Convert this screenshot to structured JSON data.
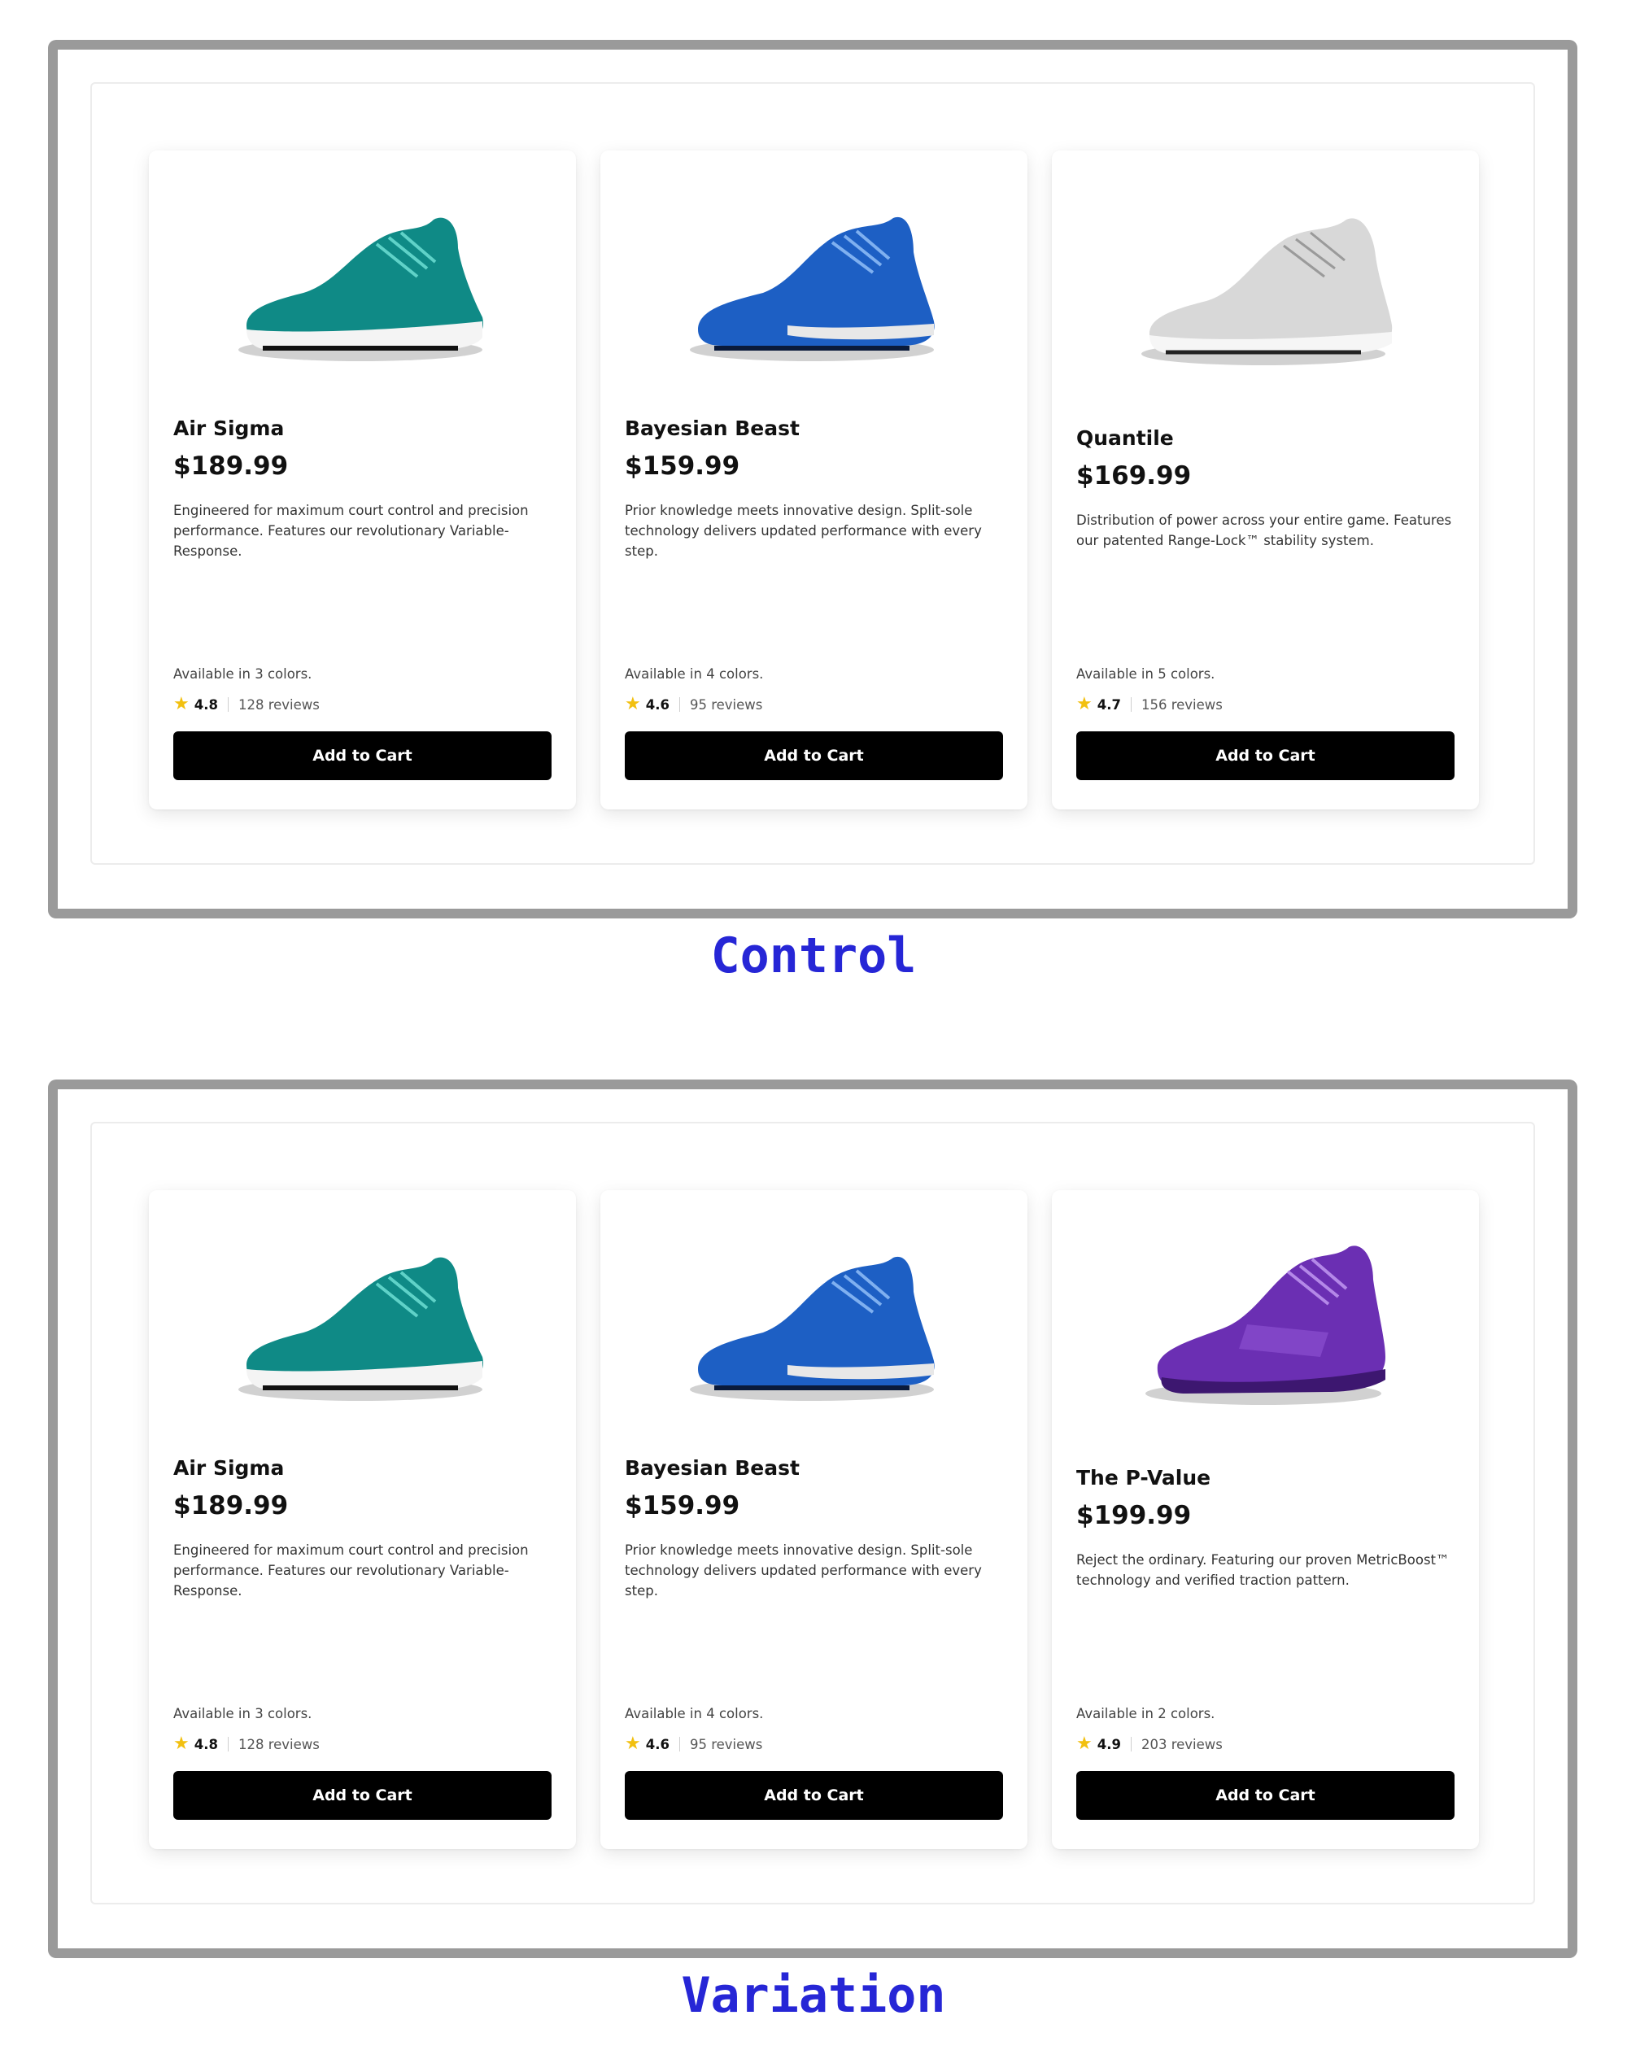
{
  "control": {
    "label": "Control",
    "products": [
      {
        "name": "Air Sigma",
        "price": "$189.99",
        "description": "Engineered for maximum court control and precision performance. Features our revolutionary Variable-Response.",
        "colors_text": "Available in 3 colors.",
        "rating": "4.8",
        "reviews": "128 reviews",
        "cta": "Add to Cart",
        "shoe_color": "#0f8a86",
        "shoe_image": "teal-sneaker"
      },
      {
        "name": "Bayesian Beast",
        "price": "$159.99",
        "description": "Prior knowledge meets innovative design. Split-sole technology delivers updated performance with every step.",
        "colors_text": "Available in 4 colors.",
        "rating": "4.6",
        "reviews": "95 reviews",
        "cta": "Add to Cart",
        "shoe_color": "#1d5fc4",
        "shoe_image": "blue-sneaker"
      },
      {
        "name": "Quantile",
        "price": "$169.99",
        "description": "Distribution of power across your entire game. Features our patented Range-Lock™ stability system.",
        "colors_text": "Available in 5 colors.",
        "rating": "4.7",
        "reviews": "156 reviews",
        "cta": "Add to Cart",
        "shoe_color": "#d8d8d8",
        "shoe_image": "white-sneaker"
      }
    ]
  },
  "variation": {
    "label": "Variation",
    "products": [
      {
        "name": "Air Sigma",
        "price": "$189.99",
        "description": "Engineered for maximum court control and precision performance. Features our revolutionary Variable-Response.",
        "colors_text": "Available in 3 colors.",
        "rating": "4.8",
        "reviews": "128 reviews",
        "cta": "Add to Cart",
        "shoe_color": "#0f8a86",
        "shoe_image": "teal-sneaker"
      },
      {
        "name": "Bayesian Beast",
        "price": "$159.99",
        "description": "Prior knowledge meets innovative design. Split-sole technology delivers updated performance with every step.",
        "colors_text": "Available in 4 colors.",
        "rating": "4.6",
        "reviews": "95 reviews",
        "cta": "Add to Cart",
        "shoe_color": "#1d5fc4",
        "shoe_image": "blue-sneaker"
      },
      {
        "name": "The P-Value",
        "price": "$199.99",
        "description": "Reject the ordinary. Featuring our proven MetricBoost™ technology and verified traction pattern.",
        "colors_text": "Available in 2 colors.",
        "rating": "4.9",
        "reviews": "203 reviews",
        "cta": "Add to Cart",
        "shoe_color": "#6b2fb3",
        "shoe_image": "purple-sneaker"
      }
    ]
  },
  "colors": {
    "label_color": "#2626d6",
    "star_color": "#f2c010",
    "button_bg": "#000000"
  }
}
